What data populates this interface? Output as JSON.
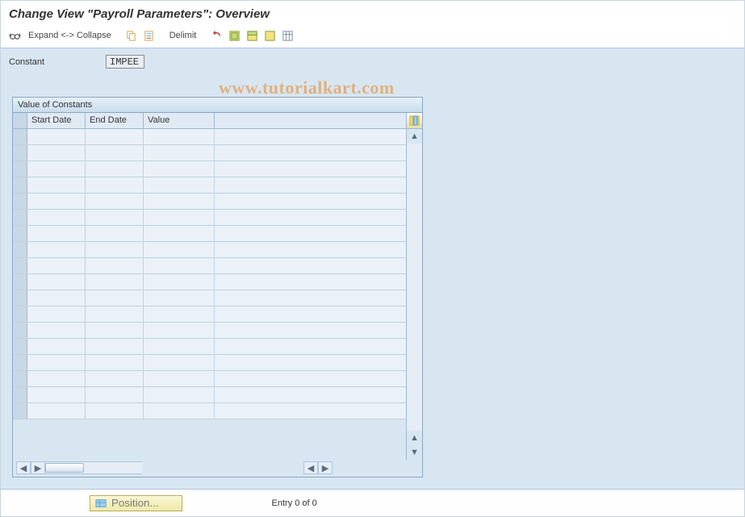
{
  "title": "Change View \"Payroll Parameters\": Overview",
  "toolbar": {
    "expand_collapse": "Expand <-> Collapse",
    "delimit": "Delimit"
  },
  "field": {
    "constant_label": "Constant",
    "constant_value": "IMPEE"
  },
  "panel": {
    "title": "Value of Constants",
    "columns": {
      "start_date": "Start Date",
      "end_date": "End Date",
      "value": "Value"
    },
    "rows": [
      {
        "start": "",
        "end": "",
        "value": ""
      },
      {
        "start": "",
        "end": "",
        "value": ""
      },
      {
        "start": "",
        "end": "",
        "value": ""
      },
      {
        "start": "",
        "end": "",
        "value": ""
      },
      {
        "start": "",
        "end": "",
        "value": ""
      },
      {
        "start": "",
        "end": "",
        "value": ""
      },
      {
        "start": "",
        "end": "",
        "value": ""
      },
      {
        "start": "",
        "end": "",
        "value": ""
      },
      {
        "start": "",
        "end": "",
        "value": ""
      },
      {
        "start": "",
        "end": "",
        "value": ""
      },
      {
        "start": "",
        "end": "",
        "value": ""
      },
      {
        "start": "",
        "end": "",
        "value": ""
      },
      {
        "start": "",
        "end": "",
        "value": ""
      },
      {
        "start": "",
        "end": "",
        "value": ""
      },
      {
        "start": "",
        "end": "",
        "value": ""
      },
      {
        "start": "",
        "end": "",
        "value": ""
      },
      {
        "start": "",
        "end": "",
        "value": ""
      },
      {
        "start": "",
        "end": "",
        "value": ""
      }
    ]
  },
  "status": {
    "position_button": "Position...",
    "entry_text": "Entry 0 of 0"
  },
  "watermark": "www.tutorialkart.com"
}
